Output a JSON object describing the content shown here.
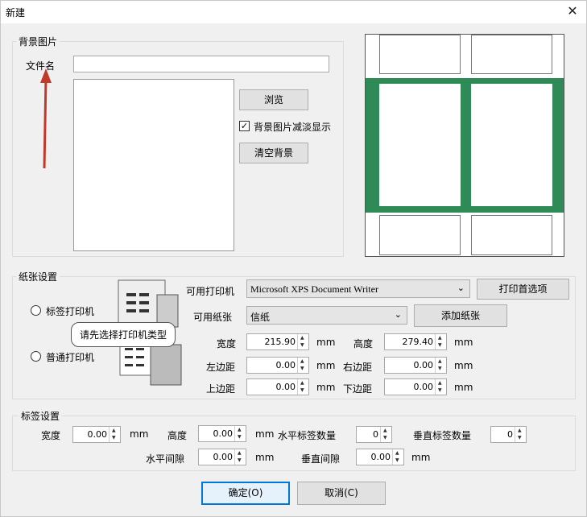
{
  "window": {
    "title": "新建",
    "close_glyph": "✕"
  },
  "background_group": {
    "title": "背景图片",
    "file_label": "文件名",
    "file_value": "",
    "browse_label": "浏览",
    "dim_checkbox_label": "背景图片减淡显示",
    "dim_checked": true,
    "clear_label": "清空背景"
  },
  "paper_group": {
    "title": "纸张设置",
    "label_printer": "标签打印机",
    "normal_printer": "普通打印机",
    "tooltip": "请先选择打印机类型",
    "available_printer_label": "可用打印机",
    "printer_value": "Microsoft XPS Document Writer",
    "print_pref_label": "打印首选项",
    "available_paper_label": "可用纸张",
    "paper_value": "信纸",
    "add_paper_label": "添加纸张",
    "width_label": "宽度",
    "width_value": "215.90",
    "height_label": "高度",
    "height_value": "279.40",
    "left_margin_label": "左边距",
    "left_margin_value": "0.00",
    "right_margin_label": "右边距",
    "right_margin_value": "0.00",
    "top_margin_label": "上边距",
    "top_margin_value": "0.00",
    "bottom_margin_label": "下边距",
    "bottom_margin_value": "0.00",
    "unit": "mm"
  },
  "label_group": {
    "title": "标签设置",
    "width_label": "宽度",
    "width_value": "0.00",
    "height_label": "高度",
    "height_value": "0.00",
    "h_count_label": "水平标签数量",
    "h_count_value": "0",
    "v_count_label": "垂直标签数量",
    "v_count_value": "0",
    "h_gap_label": "水平间隙",
    "h_gap_value": "0.00",
    "v_gap_label": "垂直间隙",
    "v_gap_value": "0.00",
    "unit": "mm"
  },
  "buttons": {
    "ok": "确定(O)",
    "cancel": "取消(C)"
  },
  "colors": {
    "preview_accent": "#2e8b57",
    "annotation_arrow": "#c0392b",
    "focus": "#0078d7"
  }
}
